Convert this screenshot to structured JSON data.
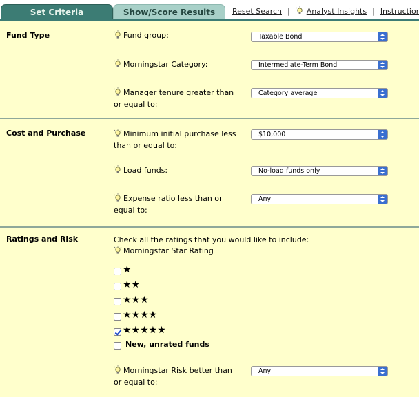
{
  "tabs": {
    "set_criteria": "Set Criteria",
    "show_score": "Show/Score Results"
  },
  "toplinks": {
    "reset": "Reset Search",
    "sep1": "|",
    "analyst": "Analyst Insights",
    "sep2": "|",
    "instructions": "Instructions"
  },
  "sections": {
    "fund_type": {
      "title": "Fund Type",
      "fund_group": {
        "label": "Fund group:",
        "value": "Taxable Bond"
      },
      "category": {
        "label": "Morningstar Category:",
        "value": "Intermediate-Term Bond"
      },
      "tenure": {
        "label": "Manager tenure greater than or equal to:",
        "value": "Category average"
      }
    },
    "cost": {
      "title": "Cost and Purchase",
      "min_purchase": {
        "label": "Minimum initial purchase less than or equal to:",
        "value": "$10,000"
      },
      "load": {
        "label": "Load funds:",
        "value": "No-load funds only"
      },
      "expense": {
        "label": "Expense ratio less than or equal to:",
        "value": "Any"
      }
    },
    "ratings": {
      "title": "Ratings and Risk",
      "intro": "Check all the ratings that you would like to include:",
      "star_label": "Morningstar Star Rating",
      "star_options": [
        {
          "stars": "★",
          "checked": false
        },
        {
          "stars": "★★",
          "checked": false
        },
        {
          "stars": "★★★",
          "checked": false
        },
        {
          "stars": "★★★★",
          "checked": false
        },
        {
          "stars": "★★★★★",
          "checked": true
        }
      ],
      "unrated": {
        "label": "New, unrated funds",
        "checked": false
      },
      "risk": {
        "label": "Morningstar Risk better than or equal to:",
        "value": "Any"
      }
    }
  }
}
